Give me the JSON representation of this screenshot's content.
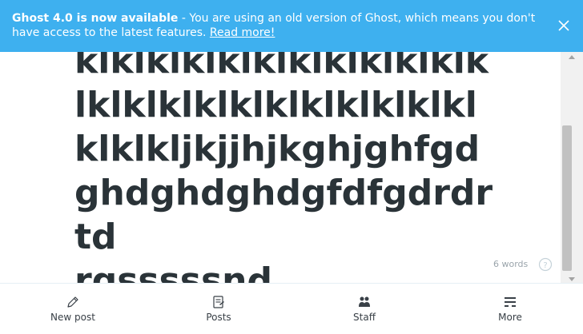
{
  "banner": {
    "headline": "Ghost 4.0 is now available",
    "message": " - You are using an old version of Ghost, which means you don't have access to the latest features. ",
    "link_label": "Read more!"
  },
  "editor": {
    "title": "drdrtdrgklklklklklklklklklklklklklklklklklklklklklklklklklklklklklklklklkljkjjhjkghjghfgdghdghdghdgfdfgdrdrtdrgsssssnd post",
    "word_count": "6 words"
  },
  "nav": {
    "new_post": "New post",
    "posts": "Posts",
    "staff": "Staff",
    "more": "More"
  },
  "colors": {
    "banner_bg": "#3eb0ef",
    "title_text": "#2a3338"
  }
}
